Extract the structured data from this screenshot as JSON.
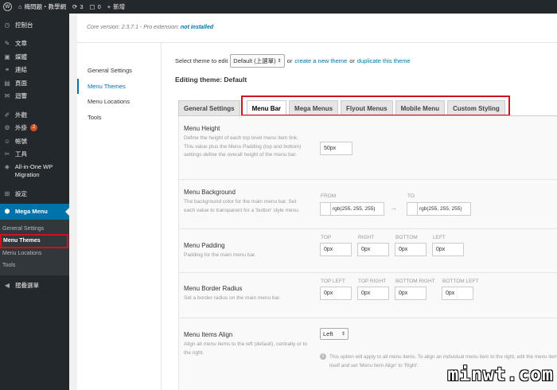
{
  "adminbar": {
    "site_name": "梅問題‧教學網",
    "updates": "3",
    "comments": "0",
    "new_label": "新增"
  },
  "sidebar": {
    "items": [
      {
        "icon": "dashboard-icon",
        "glyph": "◷",
        "label": "控制台"
      },
      {
        "icon": "pin-icon",
        "glyph": "✎",
        "label": "文章"
      },
      {
        "icon": "media-icon",
        "glyph": "▣",
        "label": "媒體"
      },
      {
        "icon": "link-icon",
        "glyph": "⚭",
        "label": "連結"
      },
      {
        "icon": "page-icon",
        "glyph": "▤",
        "label": "頁面"
      },
      {
        "icon": "comment-icon",
        "glyph": "✉",
        "label": "迴響"
      },
      {
        "icon": "appearance-icon",
        "glyph": "✐",
        "label": "外觀"
      },
      {
        "icon": "plugin-icon",
        "glyph": "⚙",
        "label": "外掛",
        "badge": "2"
      },
      {
        "icon": "user-icon",
        "glyph": "☺",
        "label": "帳號"
      },
      {
        "icon": "tools-icon",
        "glyph": "✂",
        "label": "工具"
      },
      {
        "icon": "migration-icon",
        "glyph": "◈",
        "label": "All-in-One WP Migration"
      },
      {
        "icon": "settings-icon",
        "glyph": "⊞",
        "label": "設定"
      }
    ],
    "mega_menu": {
      "icon": "mega-menu-icon",
      "glyph": "⬢",
      "label": "Mega Menu"
    },
    "submenu": [
      "General Settings",
      "Menu Themes",
      "Menu Locations",
      "Tools"
    ],
    "collapse": {
      "icon": "collapse-icon",
      "glyph": "◀",
      "label": "摺疊選單"
    }
  },
  "header": {
    "version_text": "Core version: 2.3.7.1 - Pro extension: ",
    "pro_status": "not installed"
  },
  "settings_nav": [
    "General Settings",
    "Menu Themes",
    "Menu Locations",
    "Tools"
  ],
  "theme_select": {
    "label": "Select theme to edit",
    "value": "Default (上選單)",
    "or1": "or",
    "create_link": "create a new theme",
    "or2": "or",
    "duplicate_link": "duplicate this theme"
  },
  "editing_title": "Editing theme: Default",
  "tabs": [
    "General Settings",
    "Menu Bar",
    "Mega Menus",
    "Flyout Menus",
    "Mobile Menu",
    "Custom Styling"
  ],
  "form": {
    "menu_height": {
      "label": "Menu Height",
      "desc": "Define the height of each top level menu item link. This value plus the Menu Padding (top and bottom) settings define the overall height of the menu bar.",
      "value": "50px"
    },
    "menu_background": {
      "label": "Menu Background",
      "desc": "The background color for the main menu bar. Set each value to transparent for a 'button' style menu.",
      "from_label": "FROM",
      "from_value": "rgb(255, 255, 255)",
      "to_label": "TO",
      "to_value": "rgb(255, 255, 255)"
    },
    "menu_padding": {
      "label": "Menu Padding",
      "desc": "Padding for the main menu bar.",
      "labels": [
        "TOP",
        "RIGHT",
        "BOTTOM",
        "LEFT"
      ],
      "values": [
        "0px",
        "0px",
        "0px",
        "0px"
      ]
    },
    "menu_border_radius": {
      "label": "Menu Border Radius",
      "desc": "Set a border radius on the main menu bar.",
      "labels": [
        "TOP LEFT",
        "TOP RIGHT",
        "BOTTOM RIGHT",
        "BOTTOM LEFT"
      ],
      "values": [
        "0px",
        "0px",
        "0px",
        "0px"
      ]
    },
    "menu_items_align": {
      "label": "Menu Items Align",
      "desc": "Align all menu items to the left (default), centrally or to the right.",
      "value": "Left",
      "info": "This option will apply to all menu items. To align an individual menu item to the right, edit the menu item itself and set 'Menu Item Align' to 'Right'."
    }
  },
  "watermark": "minwt.com"
}
